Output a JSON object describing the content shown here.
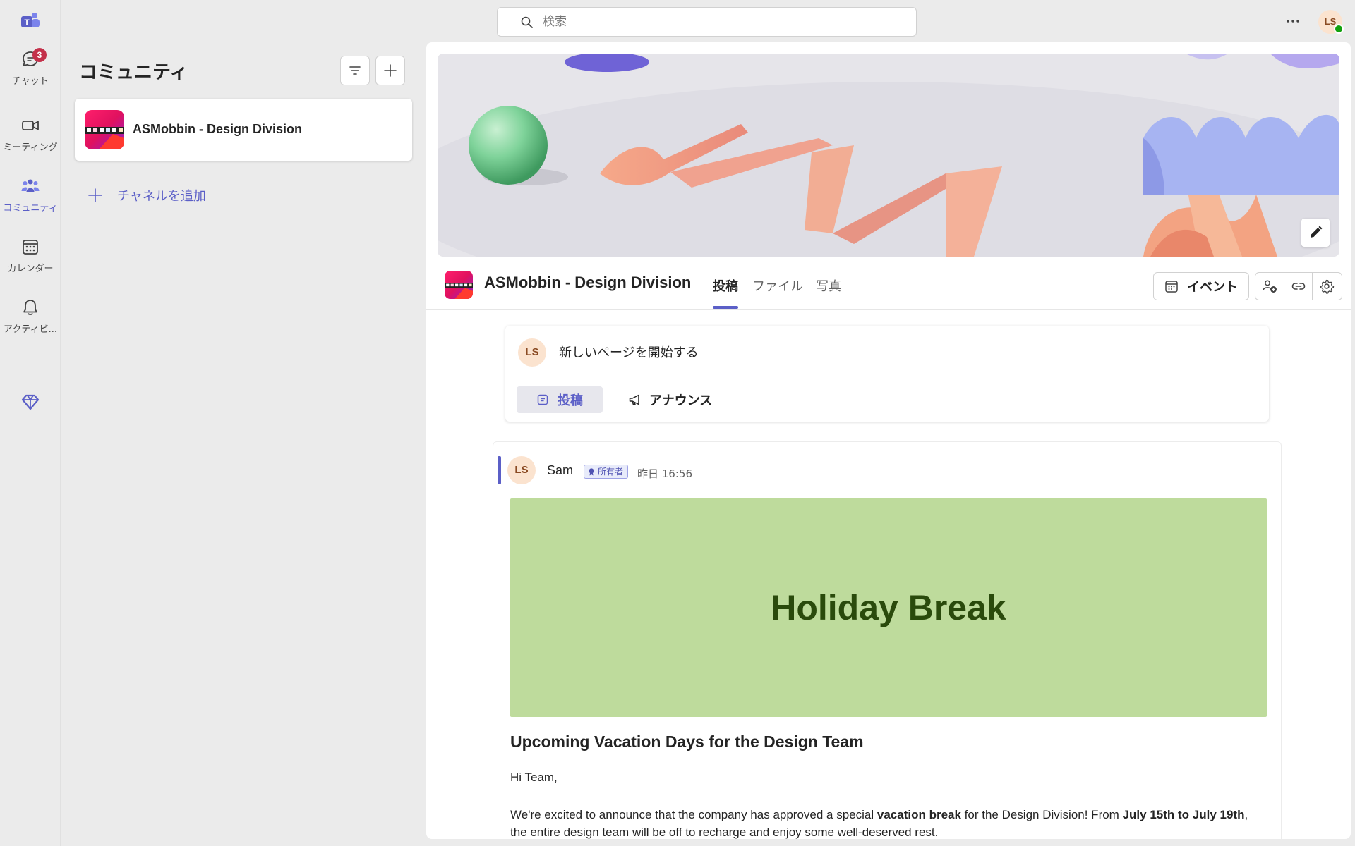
{
  "rail": {
    "items": [
      {
        "label": "チャット",
        "badge": "3"
      },
      {
        "label": "ミーティング"
      },
      {
        "label": "コミュニティ"
      },
      {
        "label": "カレンダー"
      },
      {
        "label": "アクティビ..."
      }
    ],
    "accent": "#5b5fc7",
    "badge_color": "#c4314b"
  },
  "search": {
    "placeholder": "検索"
  },
  "user": {
    "initials": "LS",
    "presence": "available"
  },
  "panel": {
    "title": "コミュニティ",
    "communities": [
      {
        "name": "ASMobbin - Design Division"
      }
    ],
    "add_channel_label": "チャネルを追加"
  },
  "community": {
    "title": "ASMobbin - Design Division",
    "tabs": [
      {
        "label": "投稿",
        "active": true
      },
      {
        "label": "ファイル"
      },
      {
        "label": "写真"
      }
    ],
    "event_label": "イベント"
  },
  "composer": {
    "avatar": "LS",
    "prompt": "新しいページを開始する",
    "post_label": "投稿",
    "announce_label": "アナウンス"
  },
  "post": {
    "avatar": "LS",
    "author": "Sam",
    "owner_badge": "所有者",
    "time": "昨日 16:56",
    "banner_text": "Holiday Break",
    "banner_color": "#bedb9c",
    "title": "Upcoming Vacation Days for the Design Team",
    "greeting": "Hi Team,",
    "body": {
      "t1": "We're excited to announce that the company has approved a special ",
      "b1": "vacation break",
      "t2": " for the Design Division! From ",
      "b2": "July 15th to July 19th",
      "t3": ", the entire design team will be off to recharge and enjoy some well-deserved rest."
    }
  }
}
